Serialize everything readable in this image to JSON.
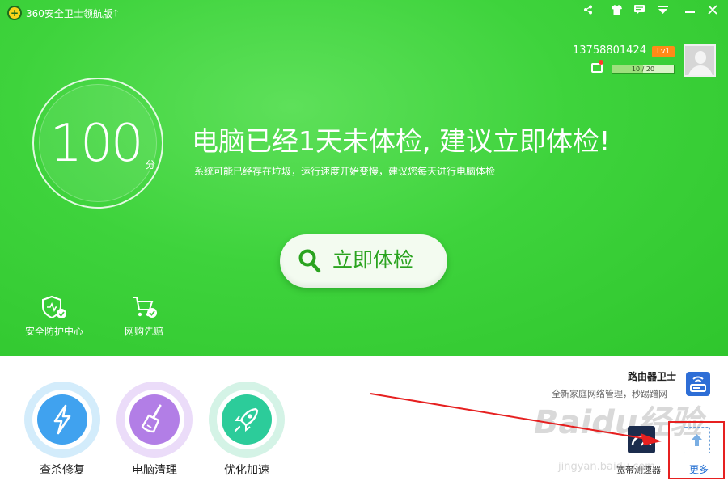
{
  "titlebar": {
    "app_title": "360安全卫士领航版",
    "upgrade_arrow": "🡑",
    "share_icon": "share-icon",
    "skin_icon": "shirt-icon",
    "feedback_icon": "chat-icon",
    "menu_icon": "menu-icon",
    "minimize_icon": "minimize-icon",
    "close_icon": "close-icon"
  },
  "user": {
    "phone": "13758801424",
    "level": "Lv1",
    "xp_text": "10 / 20",
    "xp_fraction": 0.5
  },
  "score": {
    "value": "100",
    "unit": "分"
  },
  "headline": "电脑已经1天未体检, 建议立即体检!",
  "subline": "系统可能已经存在垃圾，运行速度开始变慢，建议您每天进行电脑体检",
  "check_button": {
    "label": "立即体检"
  },
  "shortcuts": [
    {
      "label": "安全防护中心",
      "icon": "shield-check-icon"
    },
    {
      "label": "网购先赔",
      "icon": "cart-check-icon"
    }
  ],
  "tools": [
    {
      "label": "查杀修复",
      "icon": "lightning-icon",
      "color": "#2f8fe8"
    },
    {
      "label": "电脑清理",
      "icon": "broom-icon",
      "color": "#a46de0"
    },
    {
      "label": "优化加速",
      "icon": "rocket-icon",
      "color": "#1fbf8f"
    }
  ],
  "router": {
    "title": "路由器卫士",
    "desc": "全新家庭网络管理，秒踢蹭网"
  },
  "speed_test": {
    "label": "宽带测速器"
  },
  "more": {
    "label": "更多"
  },
  "watermark": {
    "main": "Baidu经验",
    "sub": "jingyan.baidu.com"
  },
  "colors": {
    "green_bg": "#3ed33c",
    "button_text": "#2aa31f",
    "level_badge": "#ff8a17",
    "highlight_box": "#e62020",
    "annotation_arrow": "#e62020",
    "more_text": "#1d6bd0"
  }
}
